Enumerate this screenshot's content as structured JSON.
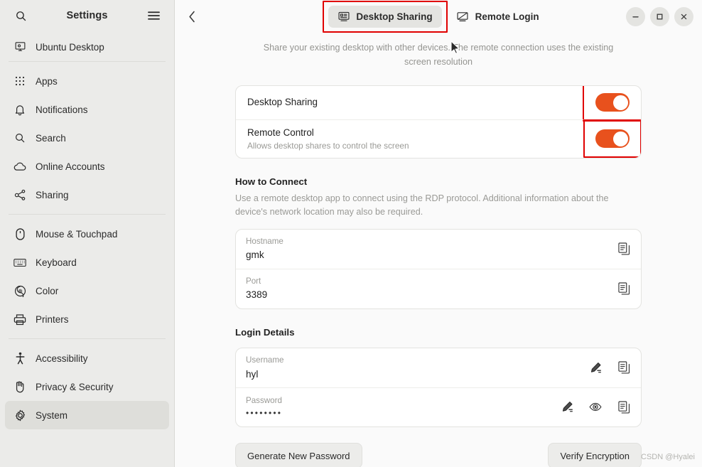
{
  "sidebar": {
    "title": "Settings",
    "search_icon": "search-icon",
    "menu_icon": "hamburger-menu-icon",
    "groups": [
      {
        "items": [
          {
            "label": "Ubuntu Desktop",
            "icon": "ubuntu-desktop-icon",
            "selected": false,
            "clipped": true
          }
        ]
      },
      {
        "items": [
          {
            "label": "Apps",
            "icon": "apps-grid-icon",
            "selected": false
          },
          {
            "label": "Notifications",
            "icon": "bell-icon",
            "selected": false
          },
          {
            "label": "Search",
            "icon": "search-icon",
            "selected": false
          },
          {
            "label": "Online Accounts",
            "icon": "cloud-icon",
            "selected": false
          },
          {
            "label": "Sharing",
            "icon": "share-nodes-icon",
            "selected": false
          }
        ]
      },
      {
        "items": [
          {
            "label": "Mouse & Touchpad",
            "icon": "mouse-icon",
            "selected": false
          },
          {
            "label": "Keyboard",
            "icon": "keyboard-icon",
            "selected": false
          },
          {
            "label": "Color",
            "icon": "color-wheel-icon",
            "selected": false
          },
          {
            "label": "Printers",
            "icon": "printer-icon",
            "selected": false
          }
        ]
      },
      {
        "items": [
          {
            "label": "Accessibility",
            "icon": "accessibility-person-icon",
            "selected": false
          },
          {
            "label": "Privacy & Security",
            "icon": "hand-shield-icon",
            "selected": false
          },
          {
            "label": "System",
            "icon": "gear-icon",
            "selected": true
          }
        ]
      }
    ]
  },
  "titlebar": {
    "back_icon": "back-chevron-icon",
    "tabs": [
      {
        "label": "Desktop Sharing",
        "icon": "desktop-sharing-icon",
        "active": true,
        "annotated": true
      },
      {
        "label": "Remote Login",
        "icon": "remote-login-icon",
        "active": false,
        "annotated": false
      }
    ],
    "window_controls": [
      {
        "name": "minimize-button",
        "glyph": "–"
      },
      {
        "name": "maximize-button",
        "glyph": "☐"
      },
      {
        "name": "close-button",
        "glyph": "✕"
      }
    ]
  },
  "page": {
    "description": "Share your existing desktop with other devices. The remote connection uses the existing screen resolution",
    "toggle_rows": [
      {
        "title": "Desktop Sharing",
        "subtitle": "",
        "state": "on",
        "annotated": true
      },
      {
        "title": "Remote Control",
        "subtitle": "Allows desktop shares to control the screen",
        "state": "on",
        "annotated": true
      }
    ],
    "how_to_connect": {
      "title": "How to Connect",
      "description": "Use a remote desktop app to connect using the RDP protocol. Additional information about the device's network location may also be required.",
      "fields": [
        {
          "label": "Hostname",
          "value": "gmk",
          "actions": [
            "copy-icon"
          ]
        },
        {
          "label": "Port",
          "value": "3389",
          "actions": [
            "copy-icon"
          ]
        }
      ]
    },
    "login_details": {
      "title": "Login Details",
      "fields": [
        {
          "label": "Username",
          "value": "hyl",
          "masked": false,
          "actions": [
            "edit-pencil-icon",
            "copy-icon"
          ]
        },
        {
          "label": "Password",
          "value": "••••••••",
          "masked": true,
          "actions": [
            "edit-pencil-icon",
            "eye-reveal-icon",
            "copy-icon"
          ]
        }
      ]
    },
    "buttons": [
      {
        "label": "Generate New Password",
        "name": "generate-new-password-button"
      },
      {
        "label": "Verify Encryption",
        "name": "verify-encryption-button"
      }
    ]
  },
  "annotation": {
    "color": "#e00000"
  },
  "watermark": "CSDN @Hyalei"
}
